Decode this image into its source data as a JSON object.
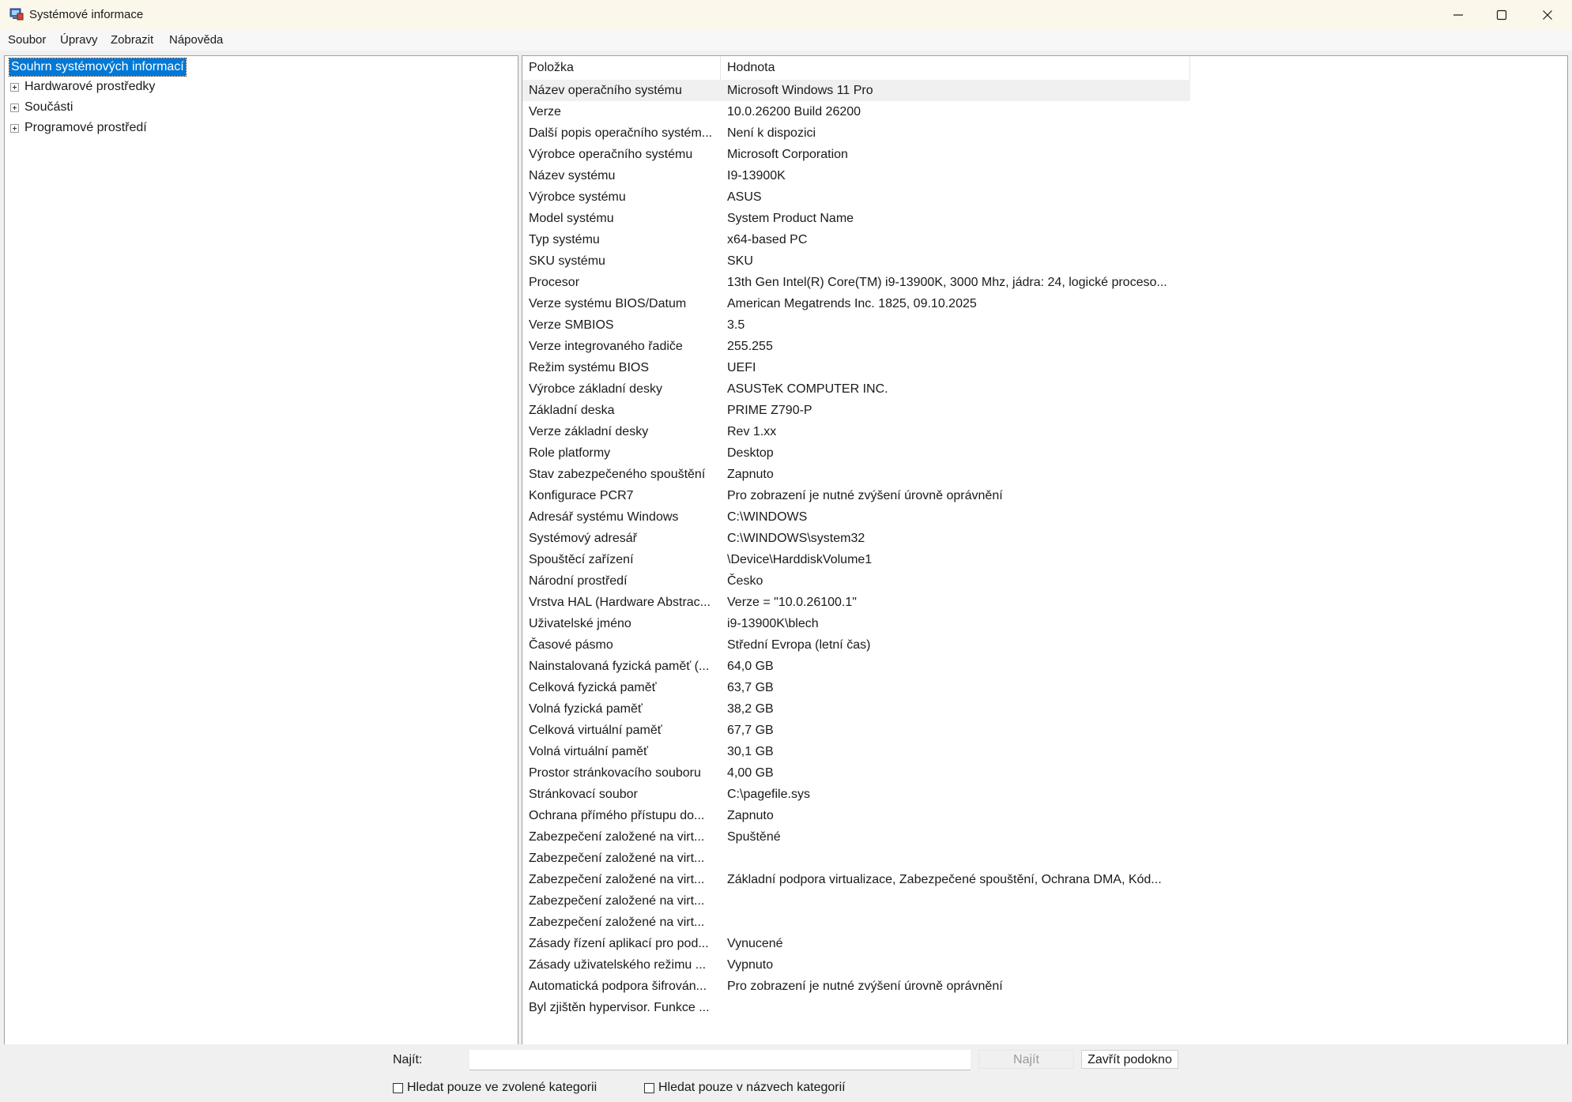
{
  "window": {
    "title": "Systémové informace",
    "controls": {
      "minimize": "minimize",
      "maximize": "maximize",
      "close": "close"
    }
  },
  "menu": {
    "items": [
      {
        "label": "Soubor"
      },
      {
        "label": "Úpravy"
      },
      {
        "label": "Zobrazit"
      },
      {
        "label": "Nápověda"
      }
    ]
  },
  "tree": {
    "root": "Souhrn systémových informací",
    "children": [
      {
        "label": "Hardwarové prostředky"
      },
      {
        "label": "Součásti"
      },
      {
        "label": "Programové prostředí"
      }
    ]
  },
  "table": {
    "headers": {
      "item": "Položka",
      "value": "Hodnota"
    },
    "rows": [
      {
        "item": "Název operačního systému",
        "value": "Microsoft Windows 11 Pro"
      },
      {
        "item": "Verze",
        "value": "10.0.26200 Build 26200"
      },
      {
        "item": "Další popis operačního systém...",
        "value": "Není k dispozici"
      },
      {
        "item": "Výrobce operačního systému",
        "value": "Microsoft Corporation"
      },
      {
        "item": "Název systému",
        "value": "I9-13900K"
      },
      {
        "item": "Výrobce systému",
        "value": "ASUS"
      },
      {
        "item": "Model systému",
        "value": "System Product Name"
      },
      {
        "item": "Typ systému",
        "value": "x64-based PC"
      },
      {
        "item": "SKU systému",
        "value": "SKU"
      },
      {
        "item": "Procesor",
        "value": "13th Gen Intel(R) Core(TM) i9-13900K, 3000 Mhz, jádra: 24, logické proceso..."
      },
      {
        "item": "Verze systému BIOS/Datum",
        "value": "American Megatrends Inc. 1825, 09.10.2025"
      },
      {
        "item": "Verze SMBIOS",
        "value": "3.5"
      },
      {
        "item": "Verze integrovaného řadiče",
        "value": "255.255"
      },
      {
        "item": "Režim systému BIOS",
        "value": "UEFI"
      },
      {
        "item": "Výrobce základní desky",
        "value": "ASUSTeK COMPUTER INC."
      },
      {
        "item": "Základní deska",
        "value": "PRIME Z790-P"
      },
      {
        "item": "Verze základní desky",
        "value": "Rev 1.xx"
      },
      {
        "item": "Role platformy",
        "value": "Desktop"
      },
      {
        "item": "Stav zabezpečeného spouštění",
        "value": "Zapnuto"
      },
      {
        "item": "Konfigurace PCR7",
        "value": "Pro zobrazení je nutné zvýšení úrovně oprávnění"
      },
      {
        "item": "Adresář systému Windows",
        "value": "C:\\WINDOWS"
      },
      {
        "item": "Systémový adresář",
        "value": "C:\\WINDOWS\\system32"
      },
      {
        "item": "Spouštěcí zařízení",
        "value": "\\Device\\HarddiskVolume1"
      },
      {
        "item": "Národní prostředí",
        "value": "Česko"
      },
      {
        "item": "Vrstva HAL (Hardware Abstrac...",
        "value": "Verze = \"10.0.26100.1\""
      },
      {
        "item": "Uživatelské jméno",
        "value": "i9-13900K\\blech"
      },
      {
        "item": "Časové pásmo",
        "value": "Střední Evropa (letní čas)"
      },
      {
        "item": "Nainstalovaná fyzická paměť (...",
        "value": "64,0 GB"
      },
      {
        "item": "Celková fyzická paměť",
        "value": "63,7 GB"
      },
      {
        "item": "Volná fyzická paměť",
        "value": "38,2 GB"
      },
      {
        "item": "Celková virtuální paměť",
        "value": "67,7 GB"
      },
      {
        "item": "Volná virtuální paměť",
        "value": "30,1 GB"
      },
      {
        "item": "Prostor stránkovacího souboru",
        "value": "4,00 GB"
      },
      {
        "item": "Stránkovací soubor",
        "value": "C:\\pagefile.sys"
      },
      {
        "item": "Ochrana přímého přístupu do...",
        "value": "Zapnuto"
      },
      {
        "item": "Zabezpečení založené na virt...",
        "value": "Spuštěné"
      },
      {
        "item": "Zabezpečení založené na virt...",
        "value": ""
      },
      {
        "item": "Zabezpečení založené na virt...",
        "value": "Základní podpora virtualizace, Zabezpečené spouštění, Ochrana DMA, Kód..."
      },
      {
        "item": "Zabezpečení založené na virt...",
        "value": ""
      },
      {
        "item": "Zabezpečení založené na virt...",
        "value": ""
      },
      {
        "item": "Zásady řízení aplikací pro pod...",
        "value": "Vynucené"
      },
      {
        "item": "Zásady uživatelského režimu ...",
        "value": "Vypnuto"
      },
      {
        "item": "Automatická podpora šifrován...",
        "value": "Pro zobrazení je nutné zvýšení úrovně oprávnění"
      },
      {
        "item": "Byl zjištěn hypervisor. Funkce ...",
        "value": ""
      }
    ]
  },
  "find": {
    "label": "Najít:",
    "input_value": "",
    "find_button": "Najít",
    "close_button": "Zavřít podokno",
    "check_selected_category": "Hledat pouze ve zvolené kategorii",
    "check_category_names": "Hledat pouze v názvech kategorií"
  }
}
